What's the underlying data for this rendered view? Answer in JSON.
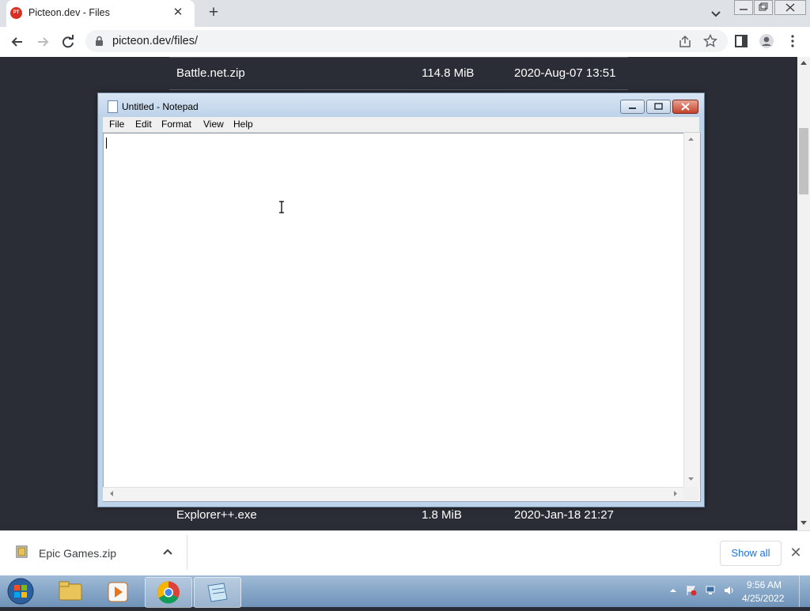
{
  "browser": {
    "tab_title": "Picteon.dev - Files",
    "favicon_text": "PT",
    "url": "picteon.dev/files/"
  },
  "page": {
    "files": [
      {
        "name": "Battle.net.zip",
        "size": "114.8 MiB",
        "date": "2020-Aug-07 13:51"
      },
      {
        "name": "Explorer++.exe",
        "size": "1.8 MiB",
        "date": "2020-Jan-18 21:27"
      }
    ]
  },
  "notepad": {
    "title": "Untitled - Notepad",
    "menu": [
      "File",
      "Edit",
      "Format",
      "View",
      "Help"
    ],
    "content": ""
  },
  "downloads": {
    "item_name": "Epic Games.zip",
    "show_all_label": "Show all"
  },
  "taskbar": {
    "time": "9:56 AM",
    "date": "4/25/2022"
  }
}
